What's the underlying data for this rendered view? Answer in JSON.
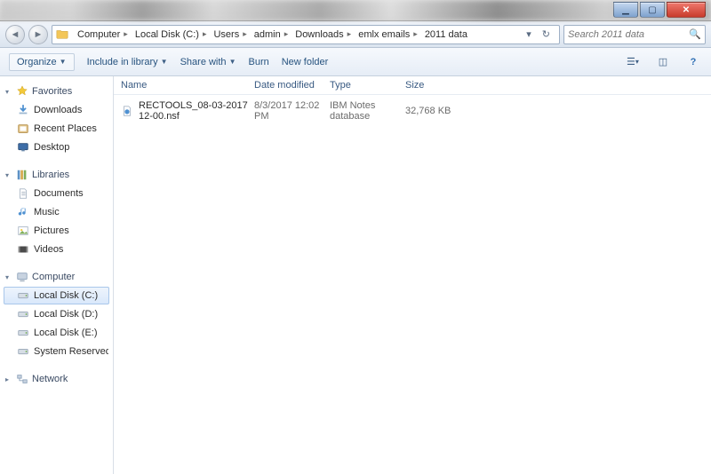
{
  "breadcrumb": {
    "segments": [
      "Computer",
      "Local Disk (C:)",
      "Users",
      "admin",
      "Downloads",
      "emlx emails",
      "2011 data"
    ]
  },
  "search": {
    "placeholder": "Search 2011 data"
  },
  "toolbar": {
    "organize": "Organize",
    "include": "Include in library",
    "share": "Share with",
    "burn": "Burn",
    "newfolder": "New folder"
  },
  "sidebar": {
    "favorites": {
      "label": "Favorites",
      "items": [
        "Downloads",
        "Recent Places",
        "Desktop"
      ]
    },
    "libraries": {
      "label": "Libraries",
      "items": [
        "Documents",
        "Music",
        "Pictures",
        "Videos"
      ]
    },
    "computer": {
      "label": "Computer",
      "items": [
        "Local Disk (C:)",
        "Local Disk (D:)",
        "Local Disk (E:)",
        "System Reserved (I:)"
      ],
      "selectedIndex": 0
    },
    "network": {
      "label": "Network"
    }
  },
  "columns": {
    "name": "Name",
    "date": "Date modified",
    "type": "Type",
    "size": "Size"
  },
  "files": [
    {
      "name": "RECTOOLS_08-03-2017 12-00.nsf",
      "date": "8/3/2017 12:02 PM",
      "type": "IBM Notes database",
      "size": "32,768 KB"
    }
  ]
}
